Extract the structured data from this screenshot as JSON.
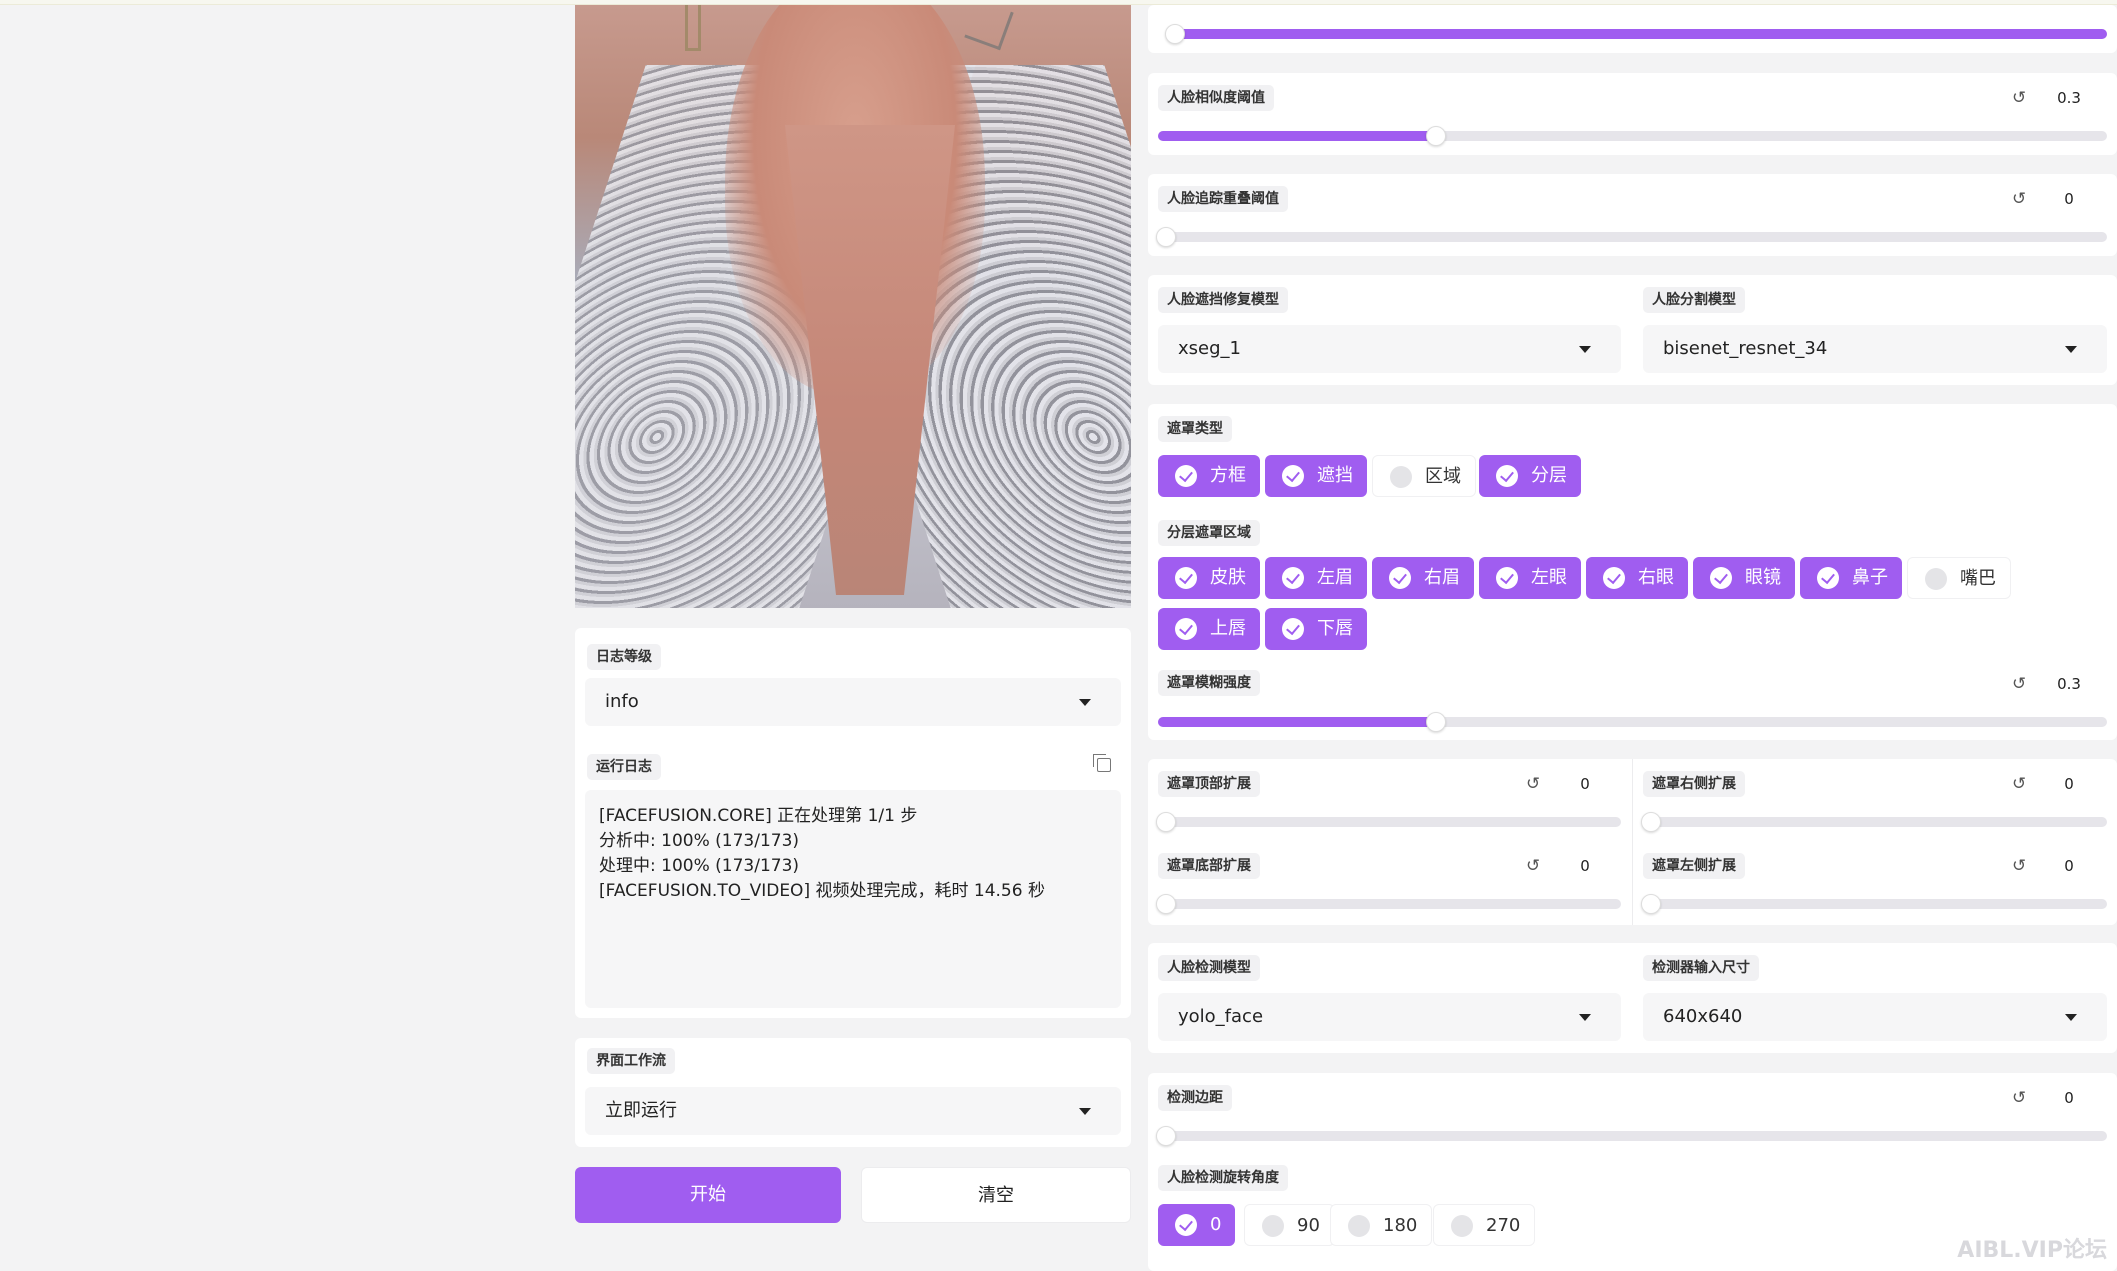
{
  "left": {
    "log_level": {
      "label": "日志等级",
      "value": "info"
    },
    "run_log": {
      "label": "运行日志",
      "lines": [
        "[FACEFUSION.CORE] 正在处理第 1/1 步",
        "分析中: 100% (173/173)",
        "处理中: 100% (173/173)",
        "[FACEFUSION.TO_VIDEO] 视频处理完成，耗时 14.56 秒"
      ]
    },
    "ui_workflow": {
      "label": "界面工作流",
      "value": "立即运行"
    },
    "start_label": "开始",
    "clear_label": "清空"
  },
  "right": {
    "top_slider": {
      "value": 1.0
    },
    "face_similarity": {
      "label": "人脸相似度阈值",
      "value": "0.3",
      "fraction": 0.3
    },
    "face_track_overlap": {
      "label": "人脸追踪重叠阈值",
      "value": "0",
      "fraction": 0
    },
    "occluder_model": {
      "label": "人脸遮挡修复模型",
      "value": "xseg_1"
    },
    "parser_model": {
      "label": "人脸分割模型",
      "value": "bisenet_resnet_34"
    },
    "mask_types": {
      "label": "遮罩类型",
      "options": [
        {
          "label": "方框",
          "checked": true
        },
        {
          "label": "遮挡",
          "checked": true
        },
        {
          "label": "区域",
          "checked": false
        },
        {
          "label": "分层",
          "checked": true
        }
      ]
    },
    "mask_regions": {
      "label": "分层遮罩区域",
      "options": [
        {
          "label": "皮肤",
          "checked": true
        },
        {
          "label": "左眉",
          "checked": true
        },
        {
          "label": "右眉",
          "checked": true
        },
        {
          "label": "左眼",
          "checked": true
        },
        {
          "label": "右眼",
          "checked": true
        },
        {
          "label": "眼镜",
          "checked": true
        },
        {
          "label": "鼻子",
          "checked": true
        },
        {
          "label": "嘴巴",
          "checked": false
        },
        {
          "label": "上唇",
          "checked": true
        },
        {
          "label": "下唇",
          "checked": true
        }
      ]
    },
    "mask_blur": {
      "label": "遮罩模糊强度",
      "value": "0.3",
      "fraction": 0.3
    },
    "padding_top": {
      "label": "遮罩顶部扩展",
      "value": "0"
    },
    "padding_right": {
      "label": "遮罩右侧扩展",
      "value": "0"
    },
    "padding_bottom": {
      "label": "遮罩底部扩展",
      "value": "0"
    },
    "padding_left": {
      "label": "遮罩左侧扩展",
      "value": "0"
    },
    "detector_model": {
      "label": "人脸检测模型",
      "value": "yolo_face"
    },
    "detector_size": {
      "label": "检测器输入尺寸",
      "value": "640x640"
    },
    "detector_margin": {
      "label": "检测边距",
      "value": "0"
    },
    "detector_angles": {
      "label": "人脸检测旋转角度",
      "options": [
        {
          "label": "0",
          "checked": true
        },
        {
          "label": "90",
          "checked": false
        },
        {
          "label": "180",
          "checked": false
        },
        {
          "label": "270",
          "checked": false
        }
      ]
    },
    "reset_icon": "reset-icon"
  },
  "watermark": "AIBL.VIP论坛",
  "colors": {
    "accent": "#a05df0",
    "panel": "#ffffff",
    "background": "#f3f3f4"
  }
}
